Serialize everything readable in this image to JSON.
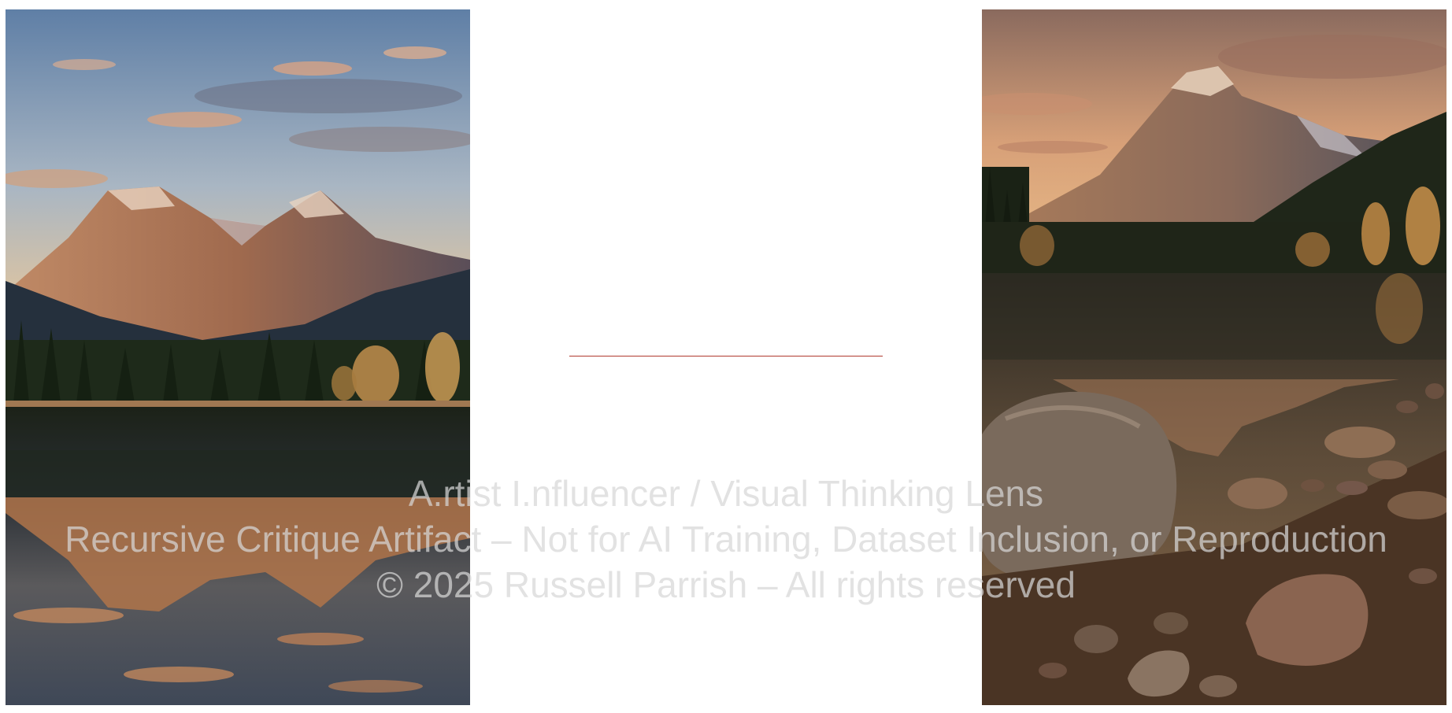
{
  "watermark": {
    "line1": "A.rtist I.nfluencer / Visual Thinking Lens",
    "line2": "Recursive Critique Artifact – Not for AI Training, Dataset Inclusion, or Reproduction",
    "line3": "© 2025 Russell Parrish – All rights reserved"
  },
  "colors": {
    "divider": "#b03a2e",
    "background": "#ffffff"
  }
}
